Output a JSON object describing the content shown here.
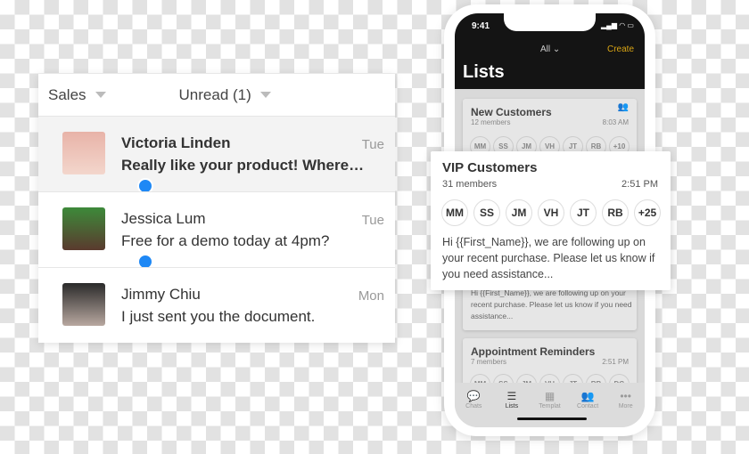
{
  "inbox": {
    "filter_inbox": "Sales",
    "filter_status": "Unread (1)",
    "conversations": [
      {
        "name": "Victoria Linden",
        "preview": "Really like your product! Where are you based?",
        "day": "Tue",
        "unread": true,
        "channel": "messenger",
        "avatar_color": "#e8b3a8"
      },
      {
        "name": "Jessica Lum",
        "preview": "Free for a demo today at 4pm?",
        "day": "Tue",
        "unread": false,
        "channel": "messenger",
        "avatar_color": "#5a3a2e"
      },
      {
        "name": "Jimmy Chiu",
        "preview": "I just sent you the document.",
        "day": "Mon",
        "unread": false,
        "channel": "",
        "avatar_color": "#8a7f78"
      }
    ]
  },
  "phone": {
    "time": "9:41",
    "status_icons": "▂▄▆ ◠ ▭",
    "filter": "All ⌄",
    "create": "Create",
    "title": "Lists",
    "lists": [
      {
        "title": "New Customers",
        "members": "12 members",
        "time": "8:03 AM",
        "chips": [
          "MM",
          "SS",
          "JM",
          "VH",
          "JT",
          "RB",
          "+10"
        ]
      },
      {
        "body": "Hi {{First_Name}}, we are following up on your recent purchase. Please let us know if you need assistance..."
      },
      {
        "title": "Appointment Reminders",
        "members": "7 members",
        "time": "2:51 PM",
        "chips": [
          "MM",
          "SS",
          "JM",
          "VH",
          "JT",
          "RB",
          "DG"
        ]
      }
    ],
    "tabs": [
      {
        "label": "Chats",
        "icon": "💬"
      },
      {
        "label": "Lists",
        "icon": "☰"
      },
      {
        "label": "Templat",
        "icon": "▦"
      },
      {
        "label": "Contact",
        "icon": "👥"
      },
      {
        "label": "More",
        "icon": "•••"
      }
    ]
  },
  "popover": {
    "title": "VIP Customers",
    "members": "31 members",
    "time": "2:51 PM",
    "chips": [
      "MM",
      "SS",
      "JM",
      "VH",
      "JT",
      "RB",
      "+25"
    ],
    "body": "Hi {{First_Name}}, we are following up on your recent purchase. Please let us know if you need assistance..."
  }
}
